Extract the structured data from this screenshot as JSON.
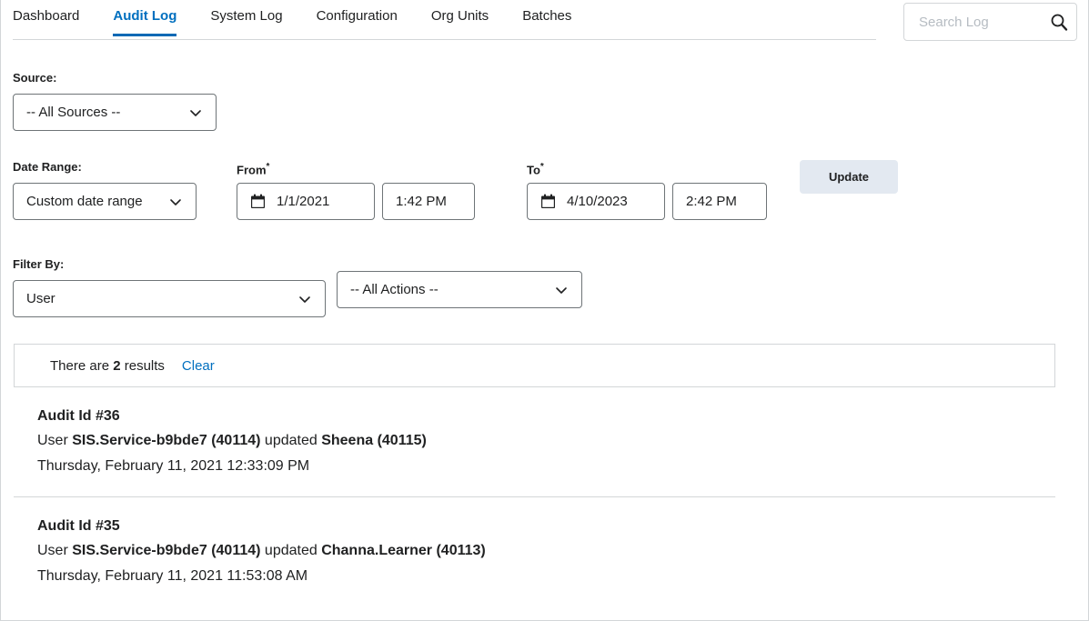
{
  "tabs": [
    {
      "label": "Dashboard",
      "active": false
    },
    {
      "label": "Audit Log",
      "active": true
    },
    {
      "label": "System Log",
      "active": false
    },
    {
      "label": "Configuration",
      "active": false
    },
    {
      "label": "Org Units",
      "active": false
    },
    {
      "label": "Batches",
      "active": false
    }
  ],
  "search": {
    "placeholder": "Search Log",
    "value": "",
    "icon": "search-icon"
  },
  "filters": {
    "source": {
      "label": "Source:",
      "value": "-- All Sources --"
    },
    "date_range": {
      "label": "Date Range:",
      "value": "Custom date range"
    },
    "from": {
      "label": "From",
      "required_mark": "*",
      "date": "1/1/2021",
      "time": "1:42 PM",
      "icon": "calendar-icon"
    },
    "to": {
      "label": "To",
      "required_mark": "*",
      "date": "4/10/2023",
      "time": "2:42 PM",
      "icon": "calendar-icon"
    },
    "update_button": "Update",
    "filter_by": {
      "label": "Filter By:",
      "value": "User"
    },
    "actions": {
      "value": "-- All Actions --"
    }
  },
  "results": {
    "count_prefix": "There are",
    "count": "2",
    "count_suffix": "results",
    "clear_label": "Clear",
    "items": [
      {
        "title": "Audit Id #36",
        "desc_prefix": "User ",
        "actor": "SIS.Service-b9bde7 (40114)",
        "desc_verb": " updated ",
        "target": "Sheena (40115)",
        "date": "Thursday, February 11, 2021 12:33:09 PM"
      },
      {
        "title": "Audit Id #35",
        "desc_prefix": "User ",
        "actor": "SIS.Service-b9bde7 (40114)",
        "desc_verb": " updated ",
        "target": "Channa.Learner (40113)",
        "date": "Thursday, February 11, 2021 11:53:08 AM"
      }
    ]
  },
  "colors": {
    "accent": "#006fbf",
    "tab_underline": "#0969b5",
    "border": "#d3d6d8",
    "control_border": "#6e7477",
    "update_button_bg": "#e3e9f1",
    "text": "#202122",
    "placeholder": "#b6bcc2"
  }
}
